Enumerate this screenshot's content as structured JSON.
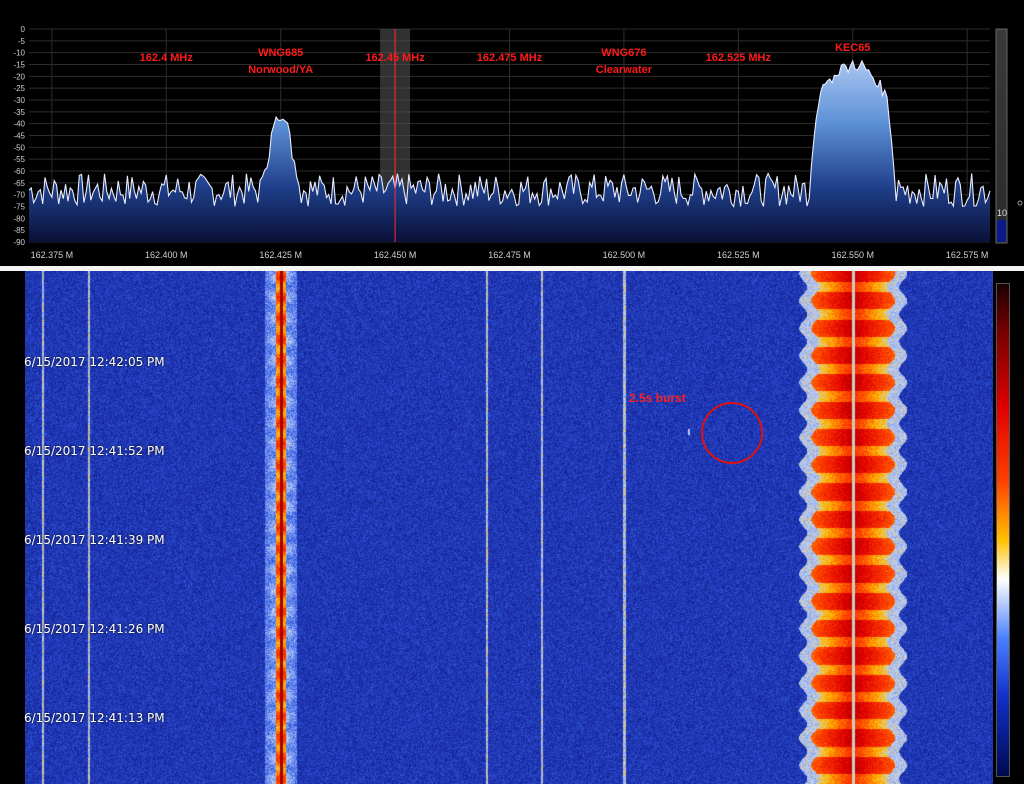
{
  "spectrum": {
    "db_ticks": [
      "0",
      "-5",
      "-10",
      "-15",
      "-20",
      "-25",
      "-30",
      "-35",
      "-40",
      "-45",
      "-50",
      "-55",
      "-60",
      "-65",
      "-70",
      "-75",
      "-80",
      "-85",
      "-90"
    ],
    "freq_ticks": [
      "162.375 M",
      "162.400 M",
      "162.425 M",
      "162.450 M",
      "162.475 M",
      "162.500 M",
      "162.525 M",
      "162.550 M",
      "162.575 M"
    ],
    "freq_values": [
      162.375,
      162.4,
      162.425,
      162.45,
      162.475,
      162.5,
      162.525,
      162.55,
      162.575
    ],
    "annotations": [
      {
        "text": "162.4 MHz",
        "freq": 162.4,
        "line2": ""
      },
      {
        "text": "WNG685",
        "freq": 162.425,
        "line2": "Norwood/YA"
      },
      {
        "text": "162.45 MHz",
        "freq": 162.45,
        "line2": ""
      },
      {
        "text": "162.475 MHz",
        "freq": 162.475,
        "line2": ""
      },
      {
        "text": "WNG676",
        "freq": 162.5,
        "line2": "Clearwater"
      },
      {
        "text": "162.525 MHz",
        "freq": 162.525,
        "line2": ""
      },
      {
        "text": "KEC65",
        "freq": 162.55,
        "line2": ""
      }
    ],
    "tuned_freq": 162.45,
    "noise_floor_db": -68,
    "signals": [
      {
        "station": "WNG685",
        "freq": 162.425,
        "peak_db": -31
      },
      {
        "station": "KEC65",
        "freq": 162.55,
        "peak_db": -12
      }
    ],
    "gain_readout": "10",
    "colors": {
      "annotation": "#ff1a1a",
      "trace": "#e8ecff",
      "fill_top": "#5c8fd6",
      "fill_bottom": "#0a1038"
    }
  },
  "waterfall": {
    "timestamps": [
      "6/15/2017 12:42:05 PM",
      "6/15/2017 12:41:52 PM",
      "6/15/2017 12:41:39 PM",
      "6/15/2017 12:41:26 PM",
      "6/15/2017 12:41:13 PM"
    ],
    "burst_label": "2.5s burst",
    "carrier_lines": [
      162.373,
      162.383,
      162.47,
      162.482,
      162.5
    ],
    "burst_freq": 162.514
  }
}
